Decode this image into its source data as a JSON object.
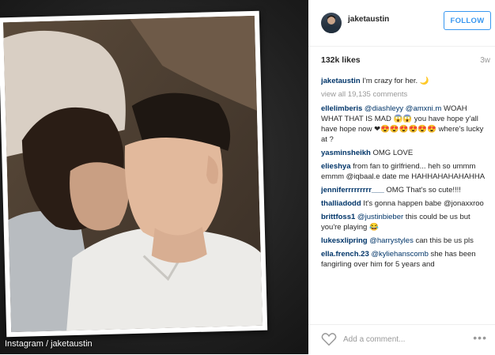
{
  "photo": {
    "credit": "Instagram / jaketaustin"
  },
  "post": {
    "username": "jaketaustin",
    "follow_label": "FOLLOW",
    "likes": "132k likes",
    "time": "3w",
    "add_comment_placeholder": "Add a comment...",
    "more_icon": "more-options-icon",
    "caption": {
      "user": "jaketaustin",
      "text": " I'm crazy for her. 🌙"
    },
    "view_all": "view all 19,135 comments",
    "comments": [
      {
        "user": "ellelimberis",
        "mention": " @diashleyy @amxni.m",
        "text": " WOAH WHAT THAT IS MAD 😱😱 you have hope y'all have hope now ❤😍😍😍😍😍😍 where's lucky at ?"
      },
      {
        "user": "yasminsheikh",
        "mention": "",
        "text": " OMG LOVE"
      },
      {
        "user": "elieshya",
        "mention": "",
        "text": " from fan to girlfriend... heh so ummm emmm @iqbaal.e date me HAHHAHAHAHAHHA"
      },
      {
        "user": "jenniferrrrrrrrr___",
        "mention": "",
        "text": " OMG That's so cute!!!!"
      },
      {
        "user": "thalliadodd",
        "mention": "",
        "text": " It's gonna happen babe @jonaxxroo"
      },
      {
        "user": "brittfoss1",
        "mention": " @justinbieber",
        "text": " this could be us but you're playing 😂"
      },
      {
        "user": "lukesxlipring",
        "mention": " @harrystyles",
        "text": " can this be us pls"
      },
      {
        "user": "ella.french.23",
        "mention": " @kyliehanscomb",
        "text": " she has been fangirling over him for 5 years and"
      }
    ]
  }
}
